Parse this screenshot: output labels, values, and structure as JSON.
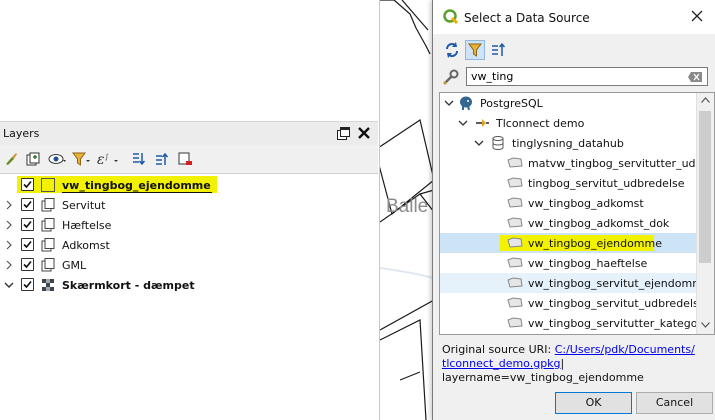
{
  "layers_panel": {
    "title": "Layers",
    "layers": [
      {
        "name": "vw_tingbog_ejendomme",
        "checked": true,
        "bold": true,
        "highlight": true,
        "icon": "empty-symbol"
      },
      {
        "name": "Servitut",
        "checked": true,
        "expander": "collapsed",
        "icon": "layer-group-icon"
      },
      {
        "name": "Hæftelse",
        "checked": true,
        "expander": "collapsed",
        "icon": "layer-group-icon"
      },
      {
        "name": "Adkomst",
        "checked": true,
        "expander": "collapsed",
        "icon": "layer-group-icon"
      },
      {
        "name": "GML",
        "checked": true,
        "expander": "collapsed",
        "icon": "layer-group-icon"
      },
      {
        "name": "Skærmkort - dæmpet",
        "checked": true,
        "bold": true,
        "expander": "expanded",
        "icon": "raster-tile-icon"
      }
    ]
  },
  "map": {
    "visible_label": "Balle"
  },
  "dialog": {
    "title": "Select a Data Source",
    "search": {
      "value": "vw_ting"
    },
    "tree": {
      "provider": "PostgreSQL",
      "connection": "Tlconnect demo",
      "schema": "tinglysning_datahub",
      "items": [
        "matvw_tingbog_servitutter_ud...",
        "tingbog_servitut_udbredelse",
        "vw_tingbog_adkomst",
        "vw_tingbog_adkomst_dok",
        "vw_tingbog_ejendomme",
        "vw_tingbog_haeftelse",
        "vw_tingbog_servitut_ejendomme",
        "vw_tingbog_servitut_udbredelse",
        "vw_tingbog_servitutter_kategori"
      ],
      "selected": "vw_tingbog_ejendomme",
      "hovered": "vw_tingbog_servitut_ejendomme"
    },
    "uri": {
      "prefix": "Original source URI: ",
      "link_part1": "C:/Users/pdk/Documents/",
      "link_part2": "tlconnect_demo.gpkg",
      "cursor": "|",
      "layername": "layername=vw_tingbog_ejendomme"
    },
    "ok_label": "OK",
    "cancel_label": "Cancel"
  },
  "colors": {
    "highlight": "#f2f200",
    "selection": "#cde4f7",
    "hover": "#e5f1fb",
    "link": "#0000ee"
  }
}
